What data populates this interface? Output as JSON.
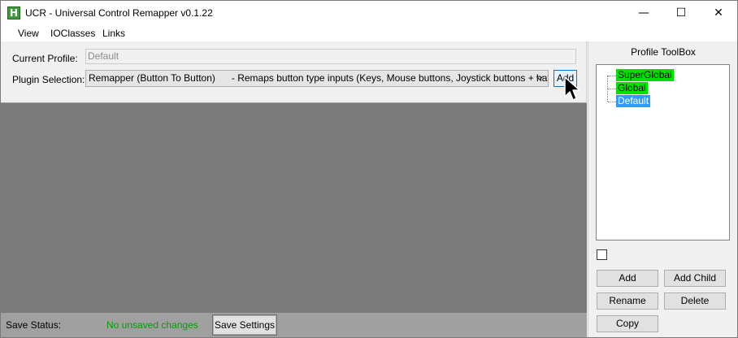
{
  "window": {
    "title": "UCR - Universal Control Remapper v0.1.22",
    "icon_letter": "H",
    "minimize_glyph": "—",
    "maximize_glyph": "☐",
    "close_glyph": "✕"
  },
  "menu": [
    "View",
    "IOClasses",
    "Links"
  ],
  "profile": {
    "label": "Current Profile:",
    "value": "Default"
  },
  "plugin": {
    "label": "Plugin Selection:",
    "selected": "Remapper (Button To Button)      - Remaps button type inputs (Keys, Mouse buttons, Joystick buttons + hat directions)",
    "add_label": "Add"
  },
  "status": {
    "label": "Save Status:",
    "value": "No unsaved changes",
    "value_color": "#00a000",
    "save_label": "Save Settings"
  },
  "toolbox": {
    "title": "Profile ToolBox",
    "tree": [
      {
        "label": "SuperGlobal",
        "highlight": "#00e000",
        "text_color": "#000000"
      },
      {
        "label": "Global",
        "highlight": "#00e000",
        "text_color": "#000000"
      },
      {
        "label": "Default",
        "highlight": "#3399ff",
        "text_color": "#ffffff"
      }
    ],
    "checkbox_checked": false,
    "buttons": {
      "add": "Add",
      "add_child": "Add Child",
      "rename": "Rename",
      "delete": "Delete",
      "copy": "Copy"
    }
  }
}
